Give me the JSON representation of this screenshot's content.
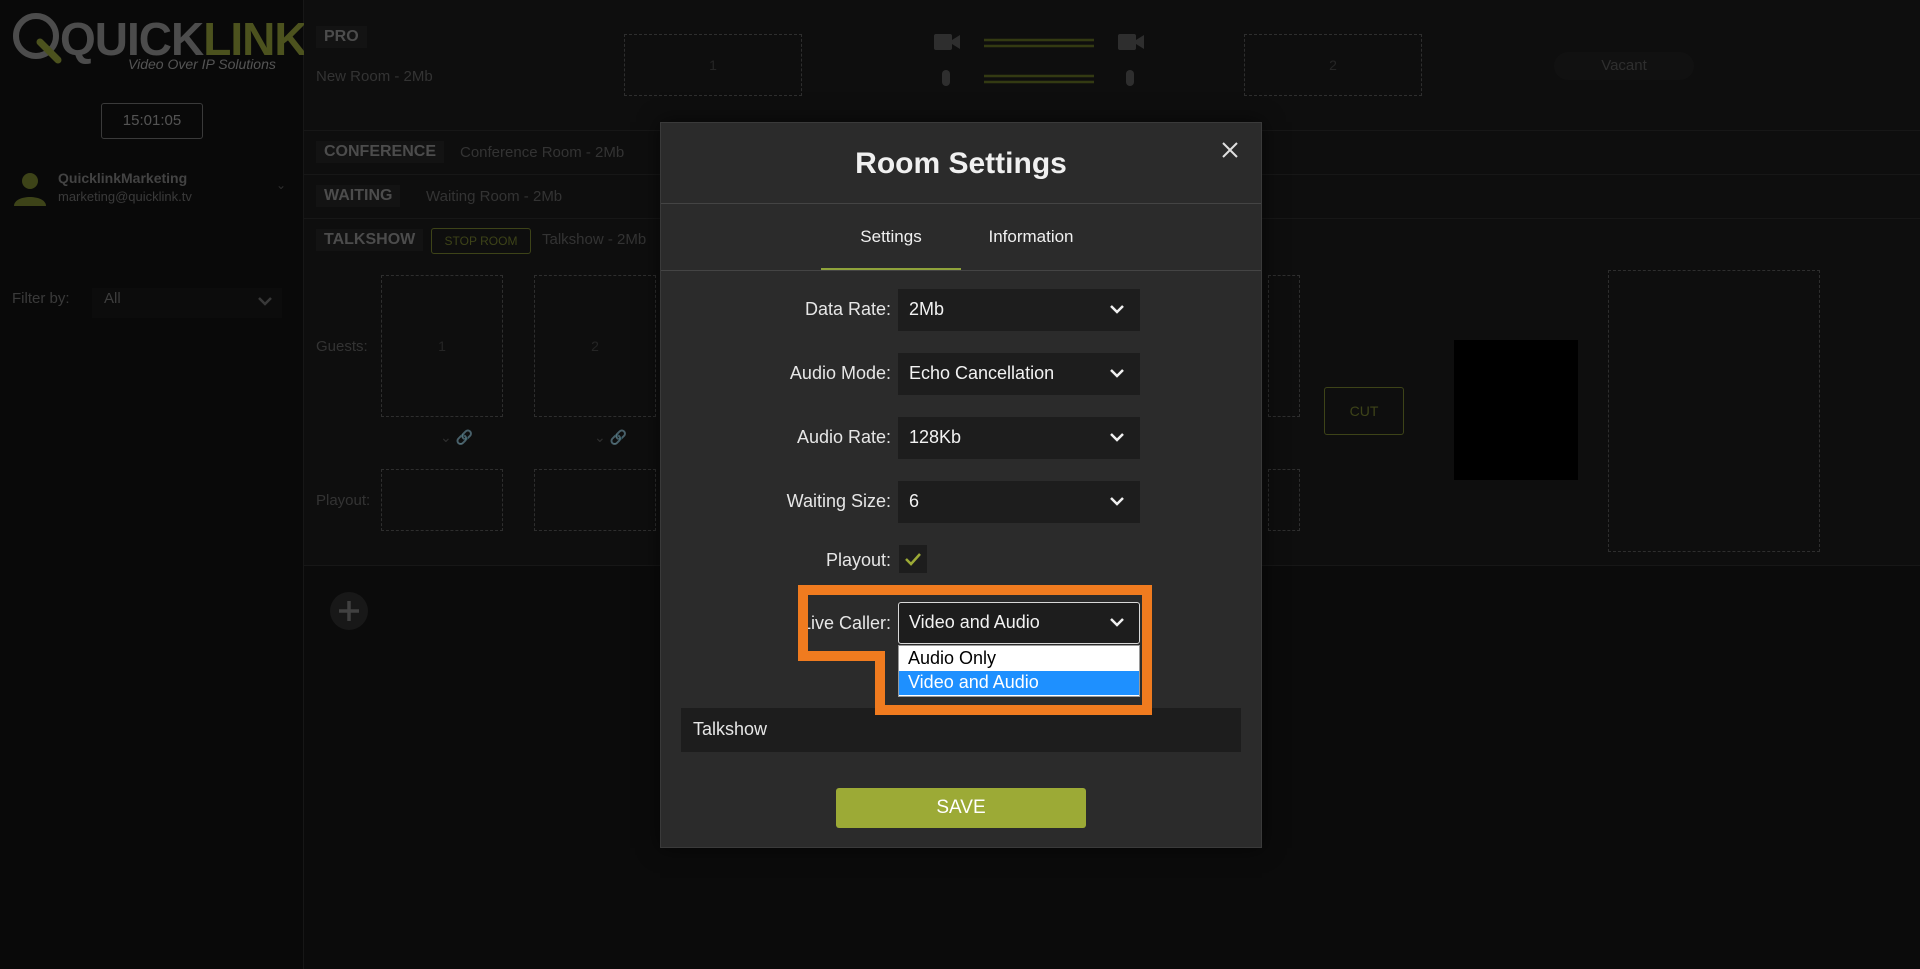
{
  "sidebar": {
    "logo_text_a": "QUICK",
    "logo_text_b": "LINK",
    "logo_tagline": "Video Over IP Solutions",
    "clock": "15:01:05",
    "user_name": "QuicklinkMarketing",
    "user_email": "marketing@quicklink.tv",
    "filter_label": "Filter by:",
    "filter_value": "All"
  },
  "rooms": {
    "pro": {
      "tag": "PRO",
      "name": "New Room - 2Mb",
      "slot1": "1",
      "slot2": "2",
      "status": "Vacant"
    },
    "conference": {
      "tag": "CONFERENCE",
      "name": "Conference Room - 2Mb"
    },
    "waiting": {
      "tag": "WAITING",
      "name": "Waiting Room - 2Mb"
    },
    "talkshow": {
      "tag": "TALKSHOW",
      "stop_label": "STOP ROOM",
      "name": "Talkshow - 2Mb",
      "guests_label": "Guests:",
      "playout_label": "Playout:",
      "guest1": "1",
      "guest2": "2",
      "cut_label": "CUT"
    }
  },
  "modal": {
    "title": "Room Settings",
    "tabs": [
      {
        "label": "Settings",
        "active": true
      },
      {
        "label": "Information",
        "active": false
      }
    ],
    "fields": {
      "data_rate": {
        "label": "Data Rate:",
        "value": "2Mb"
      },
      "audio_mode": {
        "label": "Audio Mode:",
        "value": "Echo Cancellation"
      },
      "audio_rate": {
        "label": "Audio Rate:",
        "value": "128Kb"
      },
      "waiting_size": {
        "label": "Waiting Size:",
        "value": "6"
      },
      "playout": {
        "label": "Playout:",
        "checked": true
      },
      "live_caller": {
        "label": "Live Caller:",
        "value": "Video and Audio",
        "options": [
          "Audio Only",
          "Video and Audio"
        ],
        "selected_index": 1
      }
    },
    "room_name": "Talkshow",
    "save_label": "SAVE"
  },
  "colors": {
    "accent_green": "#9caa36",
    "highlight_orange": "#f07b1f",
    "select_blue": "#1e90ff"
  }
}
